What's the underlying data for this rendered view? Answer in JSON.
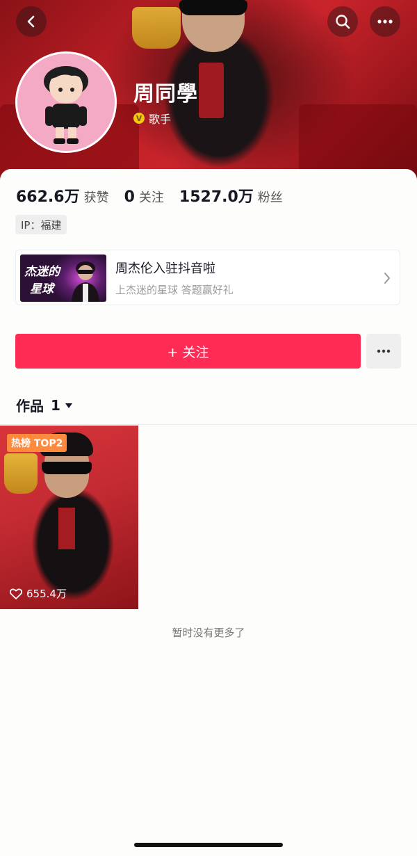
{
  "header": {
    "back_icon": "chevron-left-icon",
    "search_icon": "search-icon",
    "more_icon": "more-horizontal-icon"
  },
  "profile": {
    "name": "周同學",
    "verified_label": "歌手",
    "verified_badge": "V"
  },
  "stats": [
    {
      "value": "662.6万",
      "label": "获赞"
    },
    {
      "value": "0",
      "label": "关注"
    },
    {
      "value": "1527.0万",
      "label": "粉丝"
    }
  ],
  "ip": "IP：福建",
  "promo": {
    "thumb_line1": "杰迷的",
    "thumb_line2": "星球",
    "title": "周杰伦入驻抖音啦",
    "subtitle": "上杰迷的星球 答题赢好礼"
  },
  "actions": {
    "follow_label": "+ 关注"
  },
  "works": {
    "tab_label": "作品",
    "count": "1",
    "items": [
      {
        "badge": "热榜 TOP2",
        "likes": "655.4万"
      }
    ],
    "end_text": "暂时没有更多了"
  },
  "colors": {
    "accent": "#fe2c55",
    "hot_badge": "#ff8a3d",
    "verified": "#f5c518"
  }
}
